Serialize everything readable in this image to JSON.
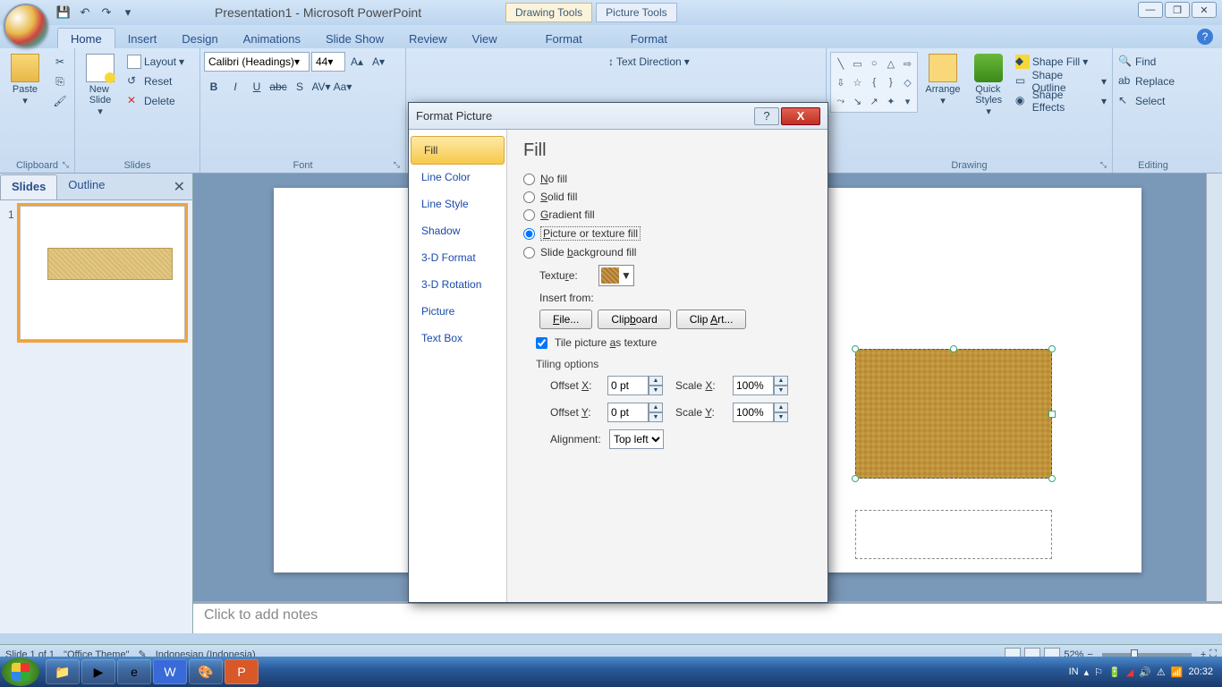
{
  "titlebar": {
    "title": "Presentation1 - Microsoft PowerPoint"
  },
  "contextual": {
    "drawing": "Drawing Tools",
    "picture": "Picture Tools"
  },
  "tabs": {
    "home": "Home",
    "insert": "Insert",
    "design": "Design",
    "animations": "Animations",
    "slideshow": "Slide Show",
    "review": "Review",
    "view": "View",
    "format1": "Format",
    "format2": "Format"
  },
  "ribbon": {
    "clipboard": {
      "label": "Clipboard",
      "paste": "Paste"
    },
    "slides": {
      "label": "Slides",
      "new_slide": "New\nSlide",
      "layout": "Layout",
      "reset": "Reset",
      "delete": "Delete"
    },
    "font": {
      "label": "Font",
      "family": "Calibri (Headings)",
      "size": "44"
    },
    "paragraph": {
      "text_direction": "Text Direction"
    },
    "drawing": {
      "label": "Drawing",
      "arrange": "Arrange",
      "quick_styles": "Quick\nStyles",
      "shape_fill": "Shape Fill",
      "shape_outline": "Shape Outline",
      "shape_effects": "Shape Effects"
    },
    "editing": {
      "label": "Editing",
      "find": "Find",
      "replace": "Replace",
      "select": "Select"
    }
  },
  "leftpanel": {
    "slides_tab": "Slides",
    "outline_tab": "Outline",
    "thumb_num": "1"
  },
  "notes": {
    "placeholder": "Click to add notes"
  },
  "status": {
    "slide": "Slide 1 of 1",
    "theme": "\"Office Theme\"",
    "lang": "Indonesian (Indonesia)",
    "zoom": "52%"
  },
  "tray": {
    "lang": "IN",
    "time": "20:32"
  },
  "dialog": {
    "title": "Format Picture",
    "nav": {
      "fill": "Fill",
      "line_color": "Line Color",
      "line_style": "Line Style",
      "shadow": "Shadow",
      "format3d": "3-D Format",
      "rotation3d": "3-D Rotation",
      "picture": "Picture",
      "textbox": "Text Box"
    },
    "content": {
      "heading": "Fill",
      "radios": {
        "no_fill": "No fill",
        "solid": "Solid fill",
        "gradient": "Gradient fill",
        "picture": "Picture or texture fill",
        "slide_bg": "Slide background fill"
      },
      "texture_label": "Texture:",
      "insert_from": "Insert from:",
      "btn_file": "File...",
      "btn_clipboard": "Clipboard",
      "btn_clipart": "Clip Art...",
      "tile_check": "Tile picture as texture",
      "tiling_hdr": "Tiling options",
      "offset_x": "Offset X:",
      "offset_x_val": "0 pt",
      "offset_y": "Offset Y:",
      "offset_y_val": "0 pt",
      "scale_x": "Scale X:",
      "scale_x_val": "100%",
      "scale_y": "Scale Y:",
      "scale_y_val": "100%",
      "alignment": "Alignment:",
      "alignment_val": "Top left"
    }
  }
}
